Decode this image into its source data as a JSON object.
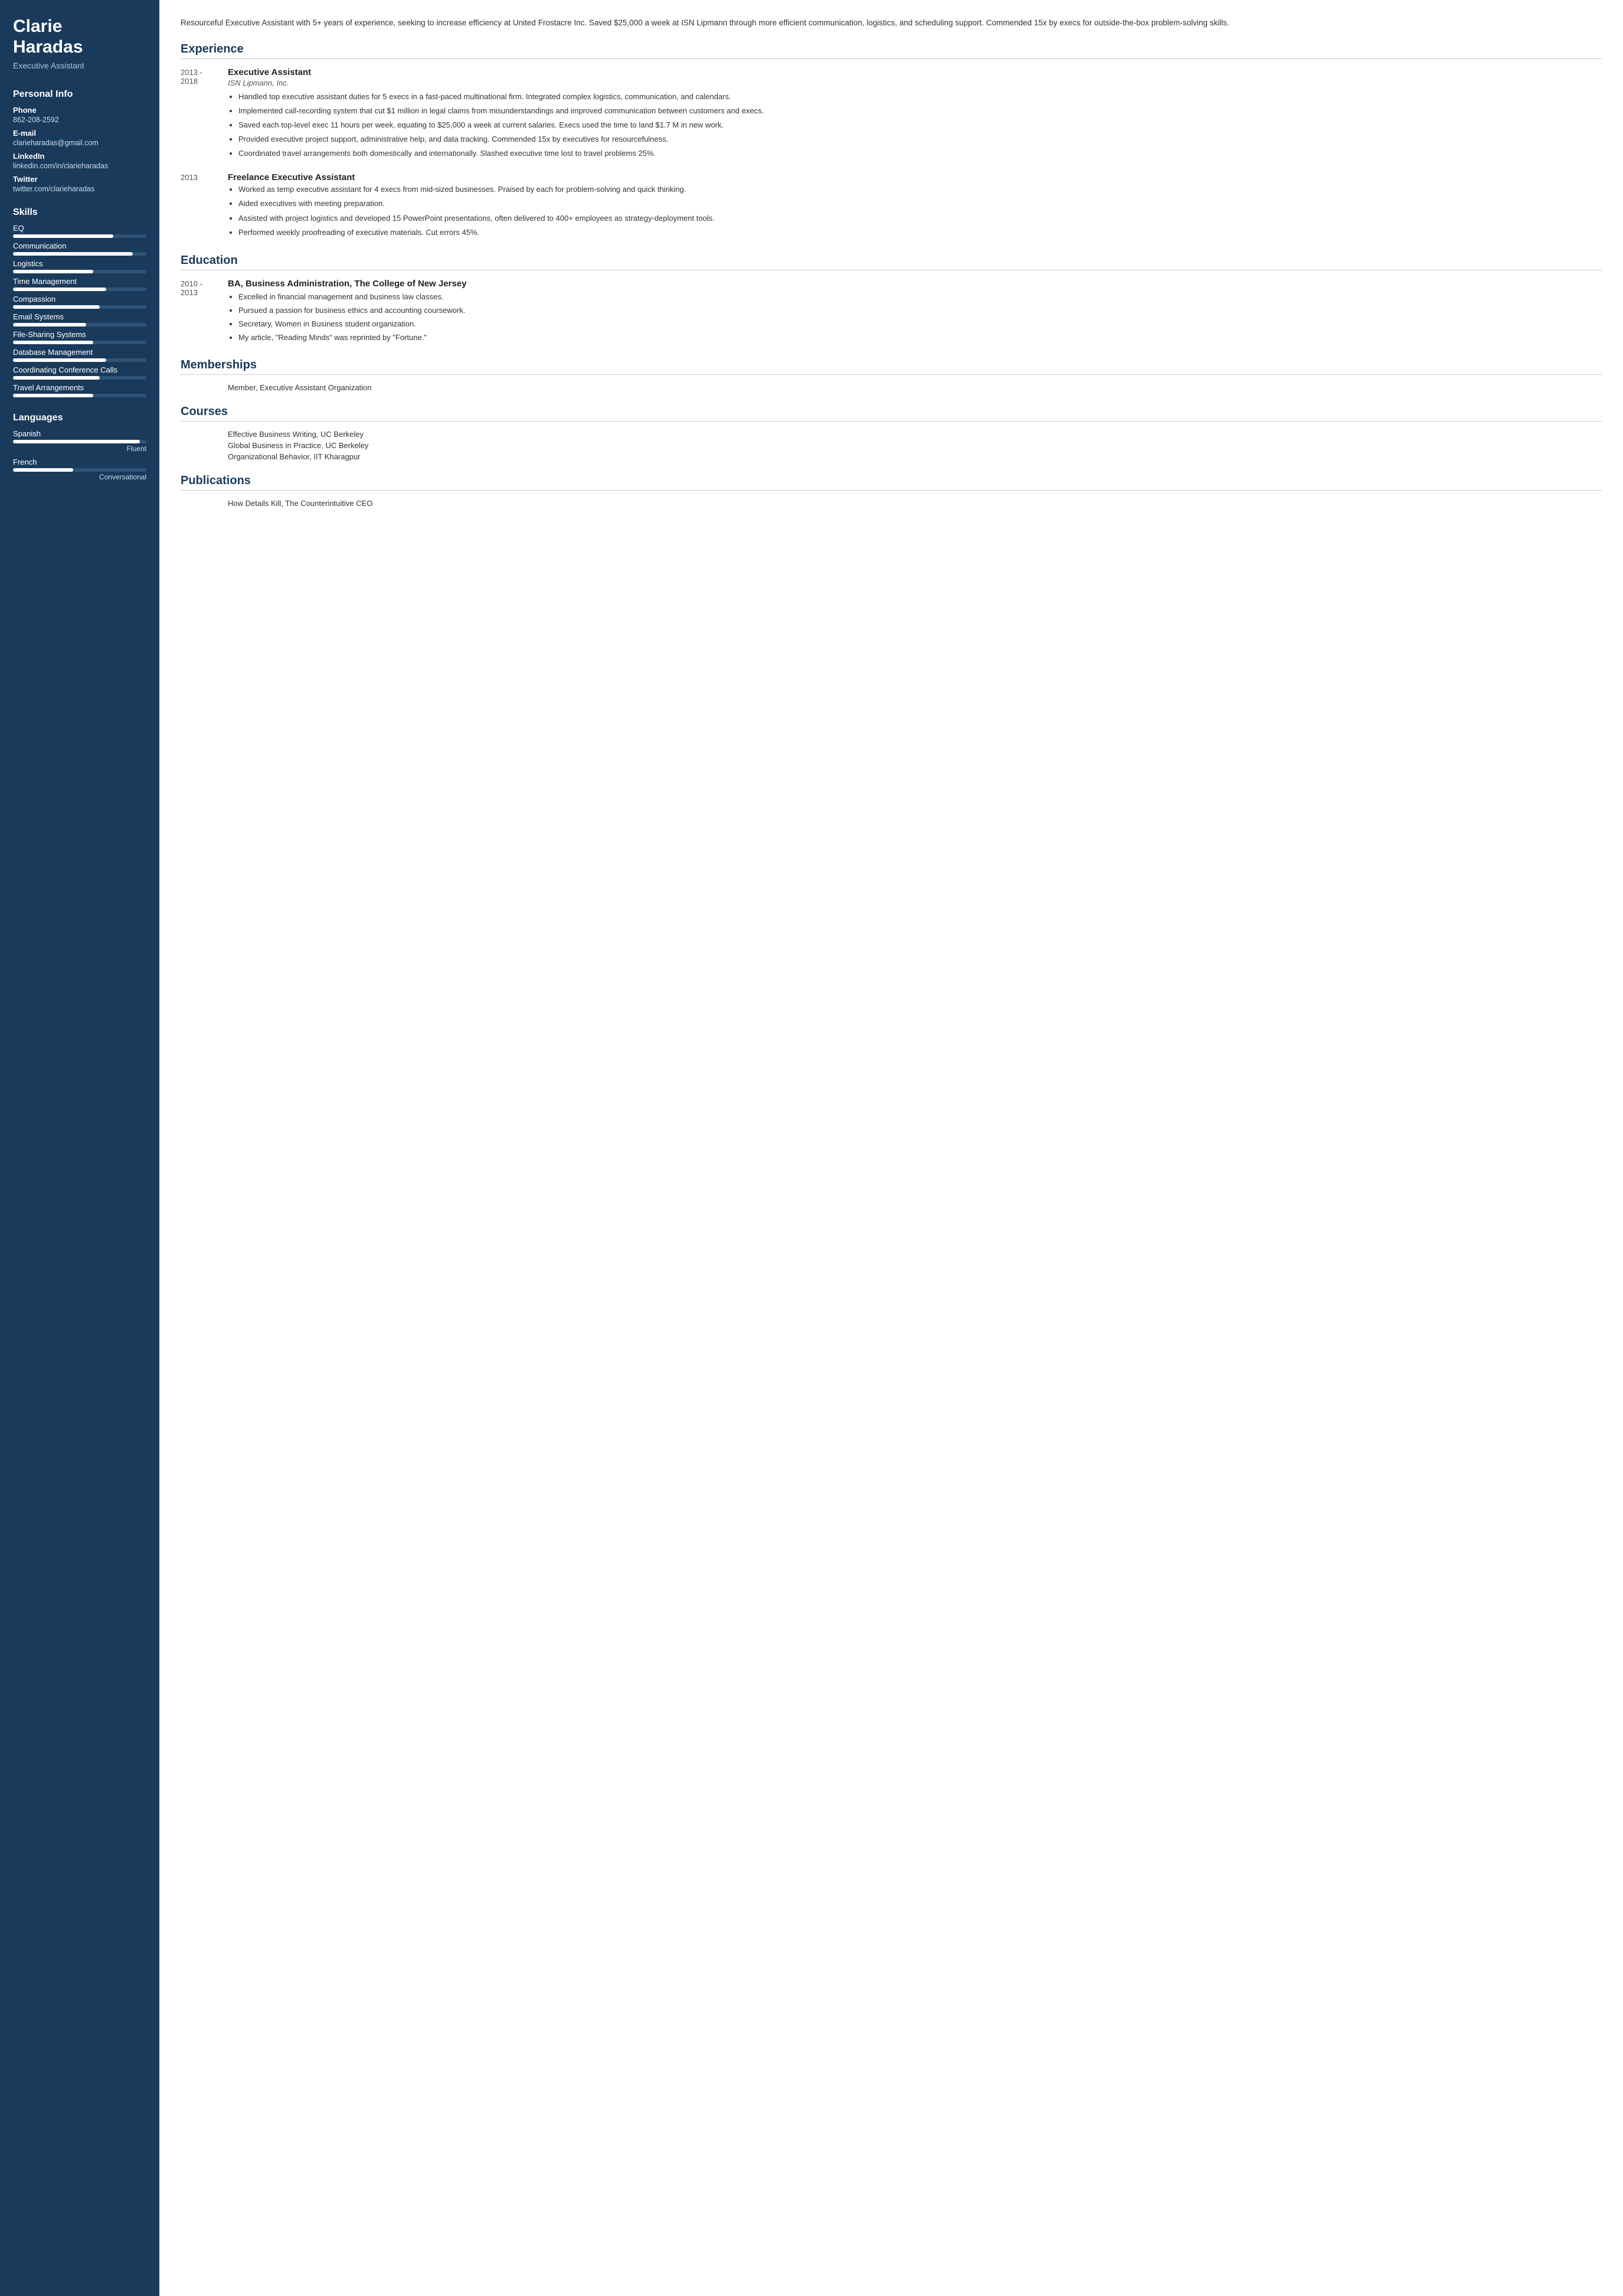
{
  "sidebar": {
    "name": "Clarie\nHaradas",
    "name_line1": "Clarie",
    "name_line2": "Haradas",
    "title": "Executive Assistant",
    "personal_info": {
      "section_title": "Personal Info",
      "phone_label": "Phone",
      "phone": "862-208-2592",
      "email_label": "E-mail",
      "email": "clarieharadas@gmail.com",
      "linkedin_label": "LinkedIn",
      "linkedin": "linkedin.com/in/clarieharadas",
      "twitter_label": "Twitter",
      "twitter": "twitter.com/clarieharadas"
    },
    "skills": {
      "section_title": "Skills",
      "items": [
        {
          "name": "EQ",
          "percent": 75
        },
        {
          "name": "Communication",
          "percent": 90
        },
        {
          "name": "Logistics",
          "percent": 60
        },
        {
          "name": "Time Management",
          "percent": 70
        },
        {
          "name": "Compassion",
          "percent": 65
        },
        {
          "name": "Email Systems",
          "percent": 55
        },
        {
          "name": "File-Sharing Systems",
          "percent": 60
        },
        {
          "name": "Database Management",
          "percent": 70
        },
        {
          "name": "Coordinating Conference Calls",
          "percent": 65
        },
        {
          "name": "Travel Arrangements",
          "percent": 60
        }
      ]
    },
    "languages": {
      "section_title": "Languages",
      "items": [
        {
          "name": "Spanish",
          "percent": 95,
          "level": "Fluent"
        },
        {
          "name": "French",
          "percent": 45,
          "level": "Conversational"
        }
      ]
    }
  },
  "main": {
    "summary": "Resourceful Executive Assistant with 5+ years of experience, seeking to increase efficiency at United Frostacre Inc. Saved $25,000 a week at ISN Lipmann through more efficient communication, logistics, and scheduling support. Commended 15x by execs for outside-the-box problem-solving skills.",
    "experience": {
      "section_title": "Experience",
      "entries": [
        {
          "date": "2013 -\n2018",
          "job_title": "Executive Assistant",
          "company": "ISN Lipmann, Inc.",
          "bullets": [
            "Handled top executive assistant duties for 5 execs in a fast-paced multinational firm. Integrated complex logistics, communication, and calendars.",
            "Implemented call-recording system that cut $1 million in legal claims from misunderstandings and improved communication between customers and execs.",
            "Saved each top-level exec 11 hours per week, equating to $25,000 a week at current salaries. Execs used the time to land $1.7 M in new work.",
            "Provided executive project support, administrative help, and data tracking. Commended 15x by executives for resourcefulness.",
            "Coordinated travel arrangements both domestically and internationally. Slashed executive time lost to travel problems 25%."
          ]
        },
        {
          "date": "2013",
          "job_title": "Freelance Executive Assistant",
          "company": "",
          "bullets": [
            "Worked as temp executive assistant for 4 execs from mid-sized businesses. Praised by each for problem-solving and quick thinking.",
            "Aided executives with meeting preparation.",
            "Assisted with project logistics and developed 15 PowerPoint presentations, often delivered to 400+ employees as strategy-deployment tools.",
            "Performed weekly proofreading of executive materials. Cut errors 45%."
          ]
        }
      ]
    },
    "education": {
      "section_title": "Education",
      "entries": [
        {
          "date": "2010 -\n2013",
          "degree": "BA, Business Administration, The College of New Jersey",
          "bullets": [
            "Excelled in financial management and business law classes.",
            "Pursued a passion for business ethics and accounting coursework.",
            "Secretary, Women in Business student organization.",
            "My article, \"Reading Minds\" was reprinted by \"Fortune.\""
          ]
        }
      ]
    },
    "memberships": {
      "section_title": "Memberships",
      "items": [
        "Member, Executive Assistant Organization"
      ]
    },
    "courses": {
      "section_title": "Courses",
      "items": [
        "Effective Business Writing, UC Berkeley",
        "Global Business in Practice, UC Berkeley",
        "Organizational Behavior, IIT Kharagpur"
      ]
    },
    "publications": {
      "section_title": "Publications",
      "items": [
        "How Details Kill, The Counterintuitive CEO"
      ]
    }
  }
}
